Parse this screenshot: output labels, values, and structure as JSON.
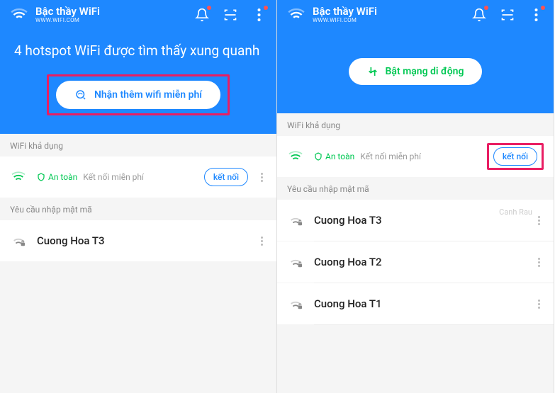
{
  "left": {
    "brand_title": "Bậc thầy WiFi",
    "brand_sub": "WWW.WIFI.COM",
    "hero_title": "4 hotspot WiFi được tìm thấy xung quanh",
    "cta_label": "Nhận thêm wifi miễn phí",
    "available_label": "WiFi khả dụng",
    "safe_label": "An toàn",
    "free_label": "Kết nối miễn phí",
    "connect_label": "kết nối",
    "password_label": "Yêu cầu nhập mật mã",
    "networks": [
      {
        "name": "Cuong Hoa T3"
      }
    ]
  },
  "right": {
    "brand_title": "Bậc thầy WiFi",
    "brand_sub": "WWW.WIFI.COM",
    "cta_label": "Bật mạng di động",
    "available_label": "WiFi khả dụng",
    "safe_label": "An toàn",
    "free_label": "Kết nối miễn phí",
    "connect_label": "kết nối",
    "password_label": "Yêu cầu nhập mật mã",
    "networks": [
      {
        "name": "Cuong Hoa T3"
      },
      {
        "name": "Cuong Hoa T2"
      },
      {
        "name": "Cuong Hoa T1"
      }
    ],
    "watermark": "Canh Rau"
  }
}
